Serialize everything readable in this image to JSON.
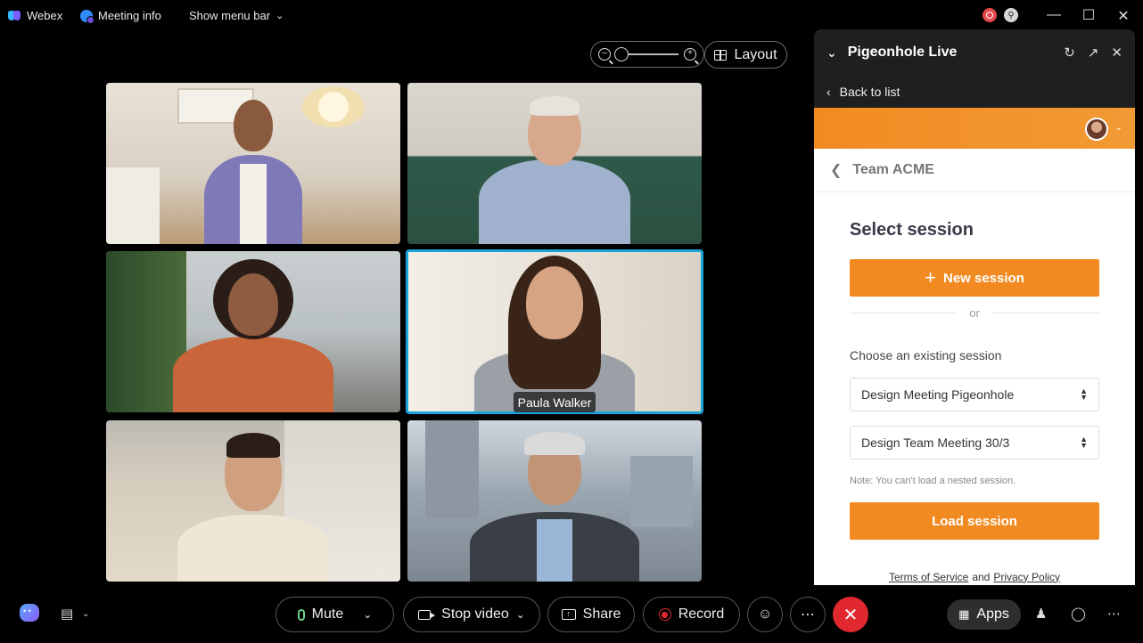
{
  "titlebar": {
    "app_name": "Webex",
    "meeting_info": "Meeting info",
    "show_menu_bar": "Show menu bar"
  },
  "controls_top": {
    "layout_label": "Layout"
  },
  "tiles": {
    "active_name": "Paula Walker"
  },
  "panel": {
    "title": "Pigeonhole Live",
    "back_label": "Back to list",
    "team_name": "Team ACME",
    "select_title": "Select session",
    "new_session_label": "New session",
    "or_label": "or",
    "choose_label": "Choose an existing session",
    "session_select_value": "Design Meeting Pigeonhole",
    "subsession_select_value": "Design Team Meeting 30/3",
    "note": "Note: You can't load a nested session.",
    "load_label": "Load session",
    "footer": {
      "terms": "Terms of Service",
      "and": "and",
      "privacy": "Privacy Policy"
    }
  },
  "bottom_bar": {
    "mute_label": "Mute",
    "stop_video_label": "Stop video",
    "share_label": "Share",
    "record_label": "Record",
    "apps_label": "Apps"
  },
  "colors": {
    "accent_orange": "#f28a22",
    "end_call_red": "#e0282e",
    "active_tile_border": "#1aa3d9",
    "mic_green": "#6ed08b"
  }
}
